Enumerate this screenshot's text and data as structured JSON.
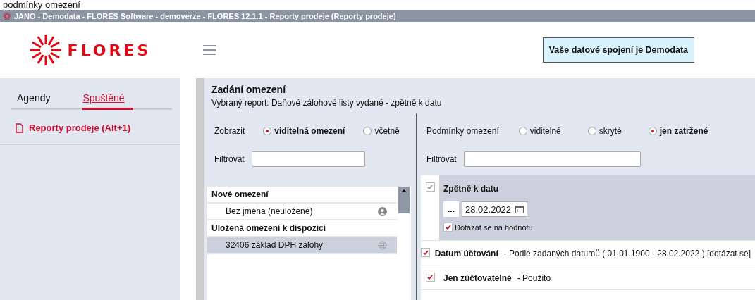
{
  "caption": "podmínky omezení",
  "window": {
    "title": "JANO - Demodata - FLORES Software - demoverze - FLORES 12.1.1 - Reporty prodeje  (Reporty prodeje)"
  },
  "header": {
    "logo": "FLORES",
    "connection": "Vaše datové spojení je Demodata"
  },
  "sidebar": {
    "tabs": [
      {
        "label": "Agendy",
        "selected": false
      },
      {
        "label": "Spuštěné",
        "selected": true
      }
    ],
    "items": [
      {
        "label": "Reporty prodeje (Alt+1)"
      }
    ]
  },
  "main": {
    "title": "Zadání omezení",
    "subtitle": "Vybraný report: Daňové zálohové listy vydané - zpětně k datu",
    "left": {
      "show_label": "Zobrazit",
      "show_options": [
        {
          "label": "viditelná omezení",
          "selected": true
        },
        {
          "label": "včetně",
          "selected": false
        }
      ],
      "filter_label": "Filtrovat",
      "groups": [
        {
          "title": "Nové omezení",
          "items": [
            {
              "label": "Bez jména (neuložené)",
              "kind": "user",
              "selected": false
            }
          ]
        },
        {
          "title": "Uložená omezení k dispozici",
          "items": [
            {
              "label": "32406 základ DPH zálohy",
              "kind": "global",
              "selected": true
            }
          ]
        }
      ]
    },
    "right": {
      "conditions_label": "Podmínky omezení",
      "condition_options": [
        {
          "label": "viditelné",
          "selected": false
        },
        {
          "label": "skryté",
          "selected": false
        },
        {
          "label": "jen zatržené",
          "selected": true
        }
      ],
      "filter_label": "Filtrovat",
      "conditions": [
        {
          "name": "Zpětně k datu",
          "checked": true,
          "expanded": true,
          "date": "28.02.2022",
          "ellipsis": "...",
          "ask_label": "Dotázat se na hodnotu",
          "ask_checked": true
        },
        {
          "name": "Datum účtování",
          "checked": true,
          "expanded": false,
          "detail": "- Podle zadaných datumů ( 01.01.1900 - 28.02.2022 ) [dotázat se]"
        },
        {
          "name": "Jen zúčtovatelné",
          "checked": true,
          "expanded": false,
          "detail": "- Použito"
        }
      ]
    }
  }
}
